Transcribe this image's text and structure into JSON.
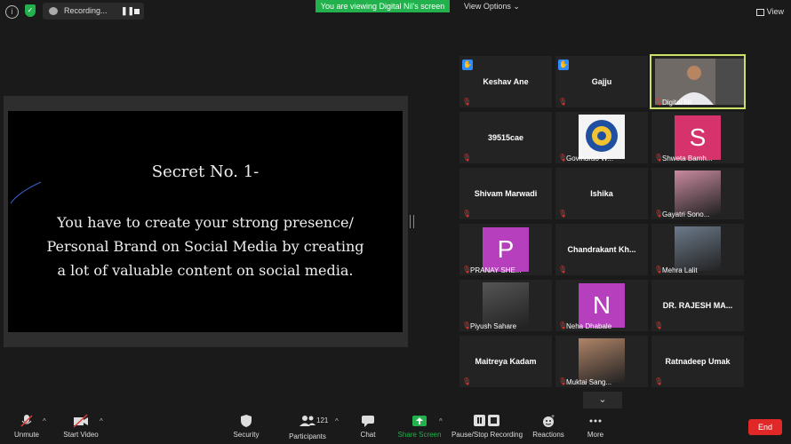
{
  "topbar": {
    "info_icon": "info-icon",
    "recording_label": "Recording...",
    "pause_glyph": "❚❚",
    "viewing_banner": "You are viewing Digital Nil's screen",
    "view_options": "View Options ⌄",
    "view_label": "View"
  },
  "shared_slide": {
    "title": "Secret No. 1-",
    "line1": "You have to create your strong presence/",
    "line2": "Personal Brand on Social Media by creating",
    "line3": "a lot of valuable content on social media."
  },
  "participants": [
    {
      "name": "Keshav Ane",
      "kind": "name",
      "raised": true
    },
    {
      "name": "Gajju",
      "kind": "name",
      "raised": true
    },
    {
      "name": "Digital Nil",
      "kind": "video",
      "active": true
    },
    {
      "name": "39515cae",
      "kind": "name"
    },
    {
      "name": "Govindrao W...",
      "kind": "logo"
    },
    {
      "name": "Shweta Bamh...",
      "kind": "avatar",
      "letter": "S",
      "color": "#d6336c"
    },
    {
      "name": "Shivam Marwadi",
      "kind": "name"
    },
    {
      "name": "Ishika",
      "kind": "name"
    },
    {
      "name": "Gayatri Sono...",
      "kind": "photo",
      "tone": "#c98aa0"
    },
    {
      "name": "PRANAY SHE...",
      "kind": "avatar",
      "letter": "P",
      "color": "#b53fbd"
    },
    {
      "name": "Chandrakant  Kh...",
      "kind": "name"
    },
    {
      "name": "Mehra Lalit",
      "kind": "photo",
      "tone": "#6c7a8a"
    },
    {
      "name": "Piyush Sahare",
      "kind": "photo",
      "tone": "#555555"
    },
    {
      "name": "Neha Dhabale",
      "kind": "avatar",
      "letter": "N",
      "color": "#b53fbd"
    },
    {
      "name": "DR. RAJESH MA...",
      "kind": "name"
    },
    {
      "name": "Maitreya Kadam",
      "kind": "name"
    },
    {
      "name": "Muktai Sang...",
      "kind": "photo",
      "tone": "#b08468"
    },
    {
      "name": "Ratnadeep Umak",
      "kind": "name"
    }
  ],
  "toolbar": {
    "unmute": "Unmute",
    "start_video": "Start Video",
    "security": "Security",
    "participants": "Participants",
    "participant_count": "121",
    "chat": "Chat",
    "share_screen": "Share Screen",
    "pause_stop_recording": "Pause/Stop Recording",
    "reactions": "Reactions",
    "more": "More",
    "end": "End"
  },
  "colors": {
    "accent_green": "#22b14c",
    "end_red": "#e02828",
    "active_outline": "#c9e265",
    "raise_hand_blue": "#2d8cff"
  }
}
